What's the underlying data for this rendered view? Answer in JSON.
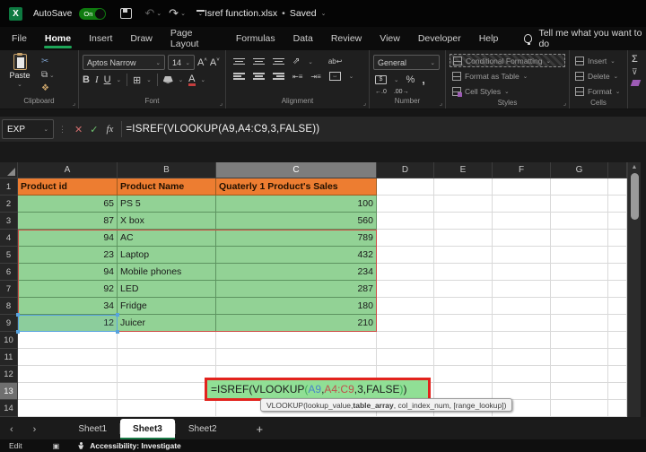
{
  "titlebar": {
    "autosave_label": "AutoSave",
    "autosave_state": "On",
    "filename": "Isref function.xlsx",
    "separator": "•",
    "saved_status": "Saved"
  },
  "ribbon_tabs": [
    {
      "label": "File",
      "active": false
    },
    {
      "label": "Home",
      "active": true
    },
    {
      "label": "Insert",
      "active": false
    },
    {
      "label": "Draw",
      "active": false
    },
    {
      "label": "Page Layout",
      "active": false
    },
    {
      "label": "Formulas",
      "active": false
    },
    {
      "label": "Data",
      "active": false
    },
    {
      "label": "Review",
      "active": false
    },
    {
      "label": "View",
      "active": false
    },
    {
      "label": "Developer",
      "active": false
    },
    {
      "label": "Help",
      "active": false
    }
  ],
  "tellme_label": "Tell me what you want to do",
  "ribbon": {
    "clipboard": {
      "label": "Clipboard",
      "paste": "Paste"
    },
    "font": {
      "label": "Font",
      "font_name": "Aptos Narrow",
      "font_size": "14"
    },
    "alignment": {
      "label": "Alignment"
    },
    "number": {
      "label": "Number",
      "format": "General"
    },
    "styles": {
      "label": "Styles",
      "items": [
        "Conditional Formatting",
        "Format as Table",
        "Cell Styles"
      ]
    },
    "cells": {
      "label": "Cells",
      "items": [
        "Insert",
        "Delete",
        "Format"
      ]
    }
  },
  "formula_bar": {
    "name_box": "EXP",
    "formula": "=ISREF(VLOOKUP(A9,A4:C9,3,FALSE))"
  },
  "sheet": {
    "col_headers": [
      "A",
      "B",
      "C",
      "D",
      "E",
      "F",
      "G",
      ""
    ],
    "active_col": "C",
    "active_row": "13",
    "rows": [
      {
        "n": "1",
        "style": "hdr",
        "cells": [
          "Product id",
          "Product Name",
          "Quaterly 1 Product's Sales"
        ]
      },
      {
        "n": "2",
        "style": "grn",
        "cells": [
          "65",
          "PS 5",
          "100"
        ]
      },
      {
        "n": "3",
        "style": "grn",
        "cells": [
          "87",
          "X box",
          "560"
        ]
      },
      {
        "n": "4",
        "style": "grn",
        "cells": [
          "94",
          "AC",
          "789"
        ]
      },
      {
        "n": "5",
        "style": "grn",
        "cells": [
          "23",
          "Laptop",
          "432"
        ]
      },
      {
        "n": "6",
        "style": "grn",
        "cells": [
          "94",
          "Mobile phones",
          "234"
        ]
      },
      {
        "n": "7",
        "style": "grn",
        "cells": [
          "92",
          "LED",
          "287"
        ]
      },
      {
        "n": "8",
        "style": "grn",
        "cells": [
          "34",
          "Fridge",
          "180"
        ]
      },
      {
        "n": "9",
        "style": "grn",
        "cells": [
          "12",
          "Juicer",
          "210"
        ]
      },
      {
        "n": "10",
        "style": "emp",
        "cells": []
      },
      {
        "n": "11",
        "style": "emp",
        "cells": []
      },
      {
        "n": "12",
        "style": "emp",
        "cells": []
      },
      {
        "n": "13",
        "style": "emp",
        "cells": []
      },
      {
        "n": "14",
        "style": "emp",
        "cells": []
      }
    ]
  },
  "edit_cell": {
    "segments": [
      {
        "t": "=ISREF(VLOOKUP",
        "c": "blk"
      },
      {
        "t": "(",
        "c": "grnp"
      },
      {
        "t": "A9",
        "c": "blue"
      },
      {
        "t": ",",
        "c": "blk"
      },
      {
        "t": "A4:C9",
        "c": "red"
      },
      {
        "t": ",3,FALSE",
        "c": "blk"
      },
      {
        "t": ")",
        "c": "grnp"
      },
      {
        "t": ")",
        "c": "blk"
      }
    ]
  },
  "formula_tooltip": {
    "segments": [
      {
        "t": "VLOOKUP(lookup_value, ",
        "b": false
      },
      {
        "t": "table_array",
        "b": true
      },
      {
        "t": ", col_index_num, [range_lookup])",
        "b": false
      }
    ]
  },
  "sheet_tabs": [
    {
      "label": "Sheet1",
      "active": false
    },
    {
      "label": "Sheet3",
      "active": true
    },
    {
      "label": "Sheet2",
      "active": false
    }
  ],
  "status_bar": {
    "mode": "Edit",
    "accessibility": "Accessibility: Investigate"
  },
  "colors": {
    "accent_green": "#1ea558",
    "header_fill": "#ED7D31",
    "data_fill": "#92d295",
    "edit_border_red": "#e2231d",
    "range_border_red": "#cd4a42",
    "ref_border_blue": "#57a3de"
  }
}
